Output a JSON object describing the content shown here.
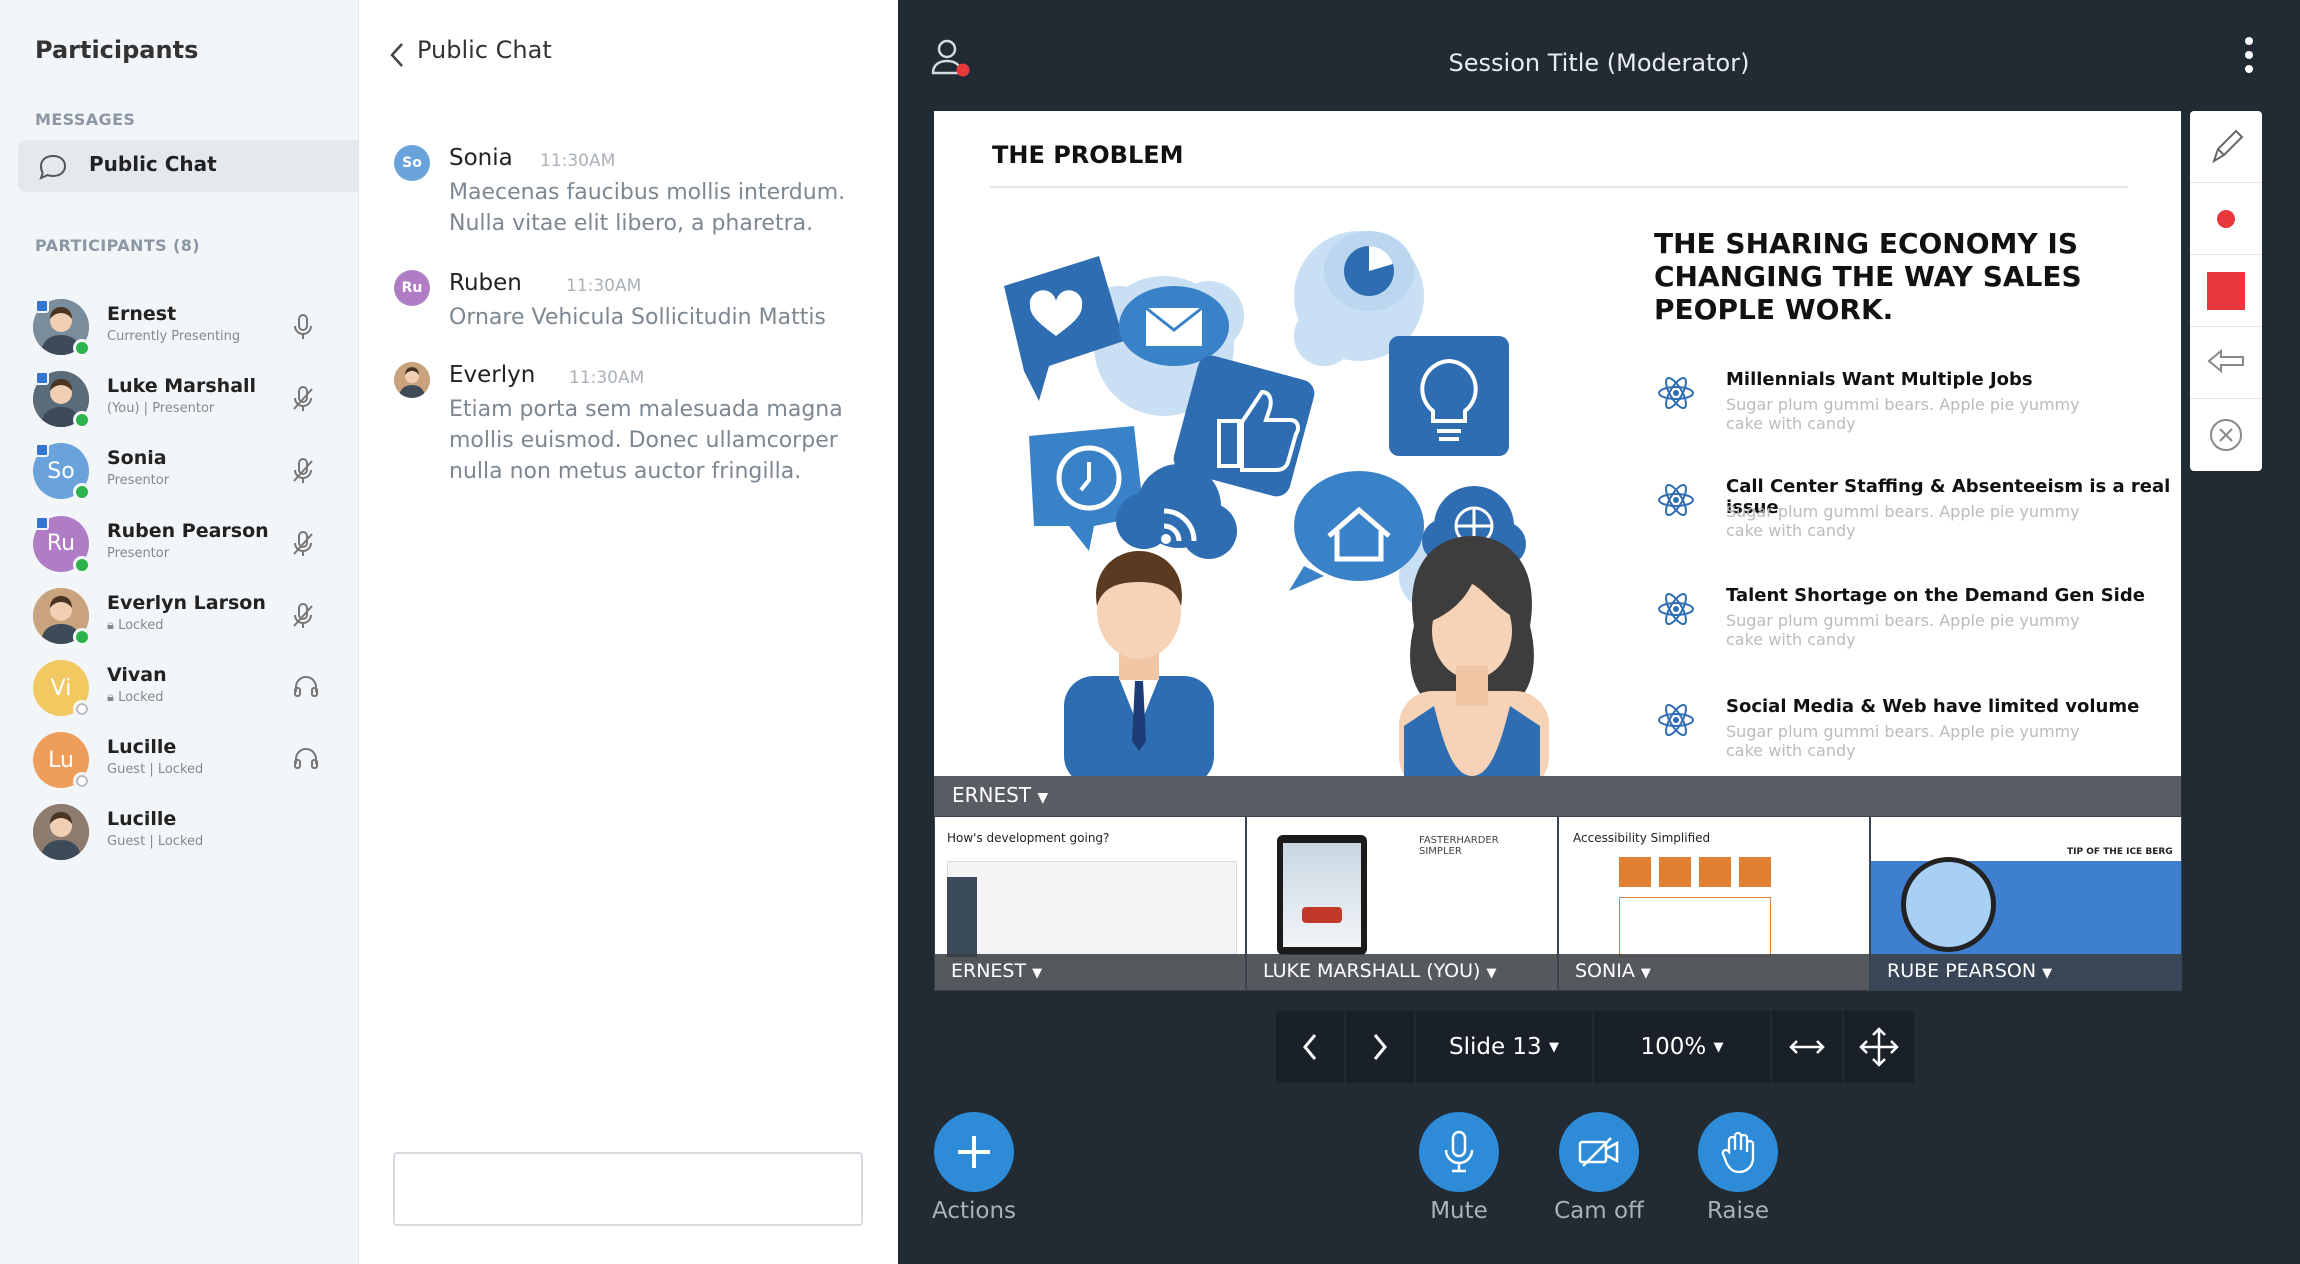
{
  "participants_panel": {
    "title": "Participants",
    "messages_label": "MESSAGES",
    "public_chat_label": "Public Chat",
    "participants_label": "PARTICIPANTS (8)",
    "items": [
      {
        "name": "Ernest",
        "sub": "Currently Presenting",
        "initials": "",
        "color": "#7a8d9c",
        "status": "#2db34a",
        "icon": "mic-icon"
      },
      {
        "name": "Luke Marshall",
        "sub": "(You)  |  Presentor",
        "initials": "",
        "color": "#5a6b7a",
        "status": "#2db34a",
        "icon": "mic-off-icon"
      },
      {
        "name": "Sonia",
        "sub": "Presentor",
        "initials": "So",
        "color": "#6aa3dc",
        "status": "#2db34a",
        "icon": "mic-off-icon"
      },
      {
        "name": "Ruben Pearson",
        "sub": "Presentor",
        "initials": "Ru",
        "color": "#b07cc6",
        "status": "#2db34a",
        "icon": "mic-off-icon"
      },
      {
        "name": "Everlyn Larson",
        "sub": "Locked",
        "initials": "",
        "color": "#c9a27e",
        "status": "#2db34a",
        "icon": "mic-off-icon"
      },
      {
        "name": "Vivan",
        "sub": "Locked",
        "initials": "Vi",
        "color": "#f2c960",
        "status": "#ffffff",
        "icon": "headphones-icon"
      },
      {
        "name": "Lucille",
        "sub": "Guest  |  Locked",
        "initials": "Lu",
        "color": "#ef9d5a",
        "status": "#ffffff",
        "icon": "headphones-icon"
      },
      {
        "name": "Lucille",
        "sub": "Guest  |  Locked",
        "initials": "",
        "color": "#8c7b6e",
        "status": "",
        "icon": ""
      }
    ]
  },
  "chat": {
    "title": "Public Chat",
    "messages": [
      {
        "name": "Sonia",
        "time": "11:30AM",
        "initials": "So",
        "color": "#6aa3dc",
        "text": "Maecenas faucibus mollis interdum. Nulla vitae elit libero, a pharetra."
      },
      {
        "name": "Ruben",
        "time": "11:30AM",
        "initials": "Ru",
        "color": "#b07cc6",
        "text": "Ornare Vehicula Sollicitudin Mattis"
      },
      {
        "name": "Everlyn",
        "time": "11:30AM",
        "initials": "",
        "color": "#c9a27e",
        "text": "Etiam porta sem malesuada magna mollis euismod. Donec ullamcorper nulla non metus auctor fringilla."
      }
    ]
  },
  "session": {
    "title": "Session Title (Moderator)"
  },
  "slide": {
    "heading": "THE PROBLEM",
    "big_title": "THE SHARING ECONOMY IS CHANGING THE WAY SALES PEOPLE WORK.",
    "bullets": [
      {
        "title": "Millennials Want Multiple Jobs",
        "sub": "Sugar plum gummi bears. Apple pie yummy cake with candy"
      },
      {
        "title": "Call Center Staffing & Absenteeism is a real issue",
        "sub": "Sugar plum gummi bears. Apple pie yummy cake with candy"
      },
      {
        "title": "Talent Shortage on the Demand Gen Side",
        "sub": "Sugar plum gummi bears. Apple pie yummy cake with candy"
      },
      {
        "title": "Social Media & Web have limited volume",
        "sub": "Sugar plum gummi bears. Apple pie yummy cake with candy"
      }
    ],
    "presenter": "ERNEST"
  },
  "thumbs": [
    {
      "label": "ERNEST",
      "caption": "How's development going?"
    },
    {
      "label": "LUKE MARSHALL (YOU)",
      "caption": "FASTERHARDER SIMPLER"
    },
    {
      "label": "SONIA",
      "caption": "Accessibility Simplified"
    },
    {
      "label": "RUBE PEARSON",
      "caption": "TIP OF THE ICE BERG"
    }
  ],
  "nav": {
    "slide": "Slide 13",
    "zoom": "100%"
  },
  "controls": {
    "actions": "Actions",
    "mute": "Mute",
    "cam": "Cam off",
    "raise": "Raise"
  },
  "colors": {
    "accent": "#2d8bd8",
    "record": "#e8383b",
    "dark": "#222a33"
  }
}
